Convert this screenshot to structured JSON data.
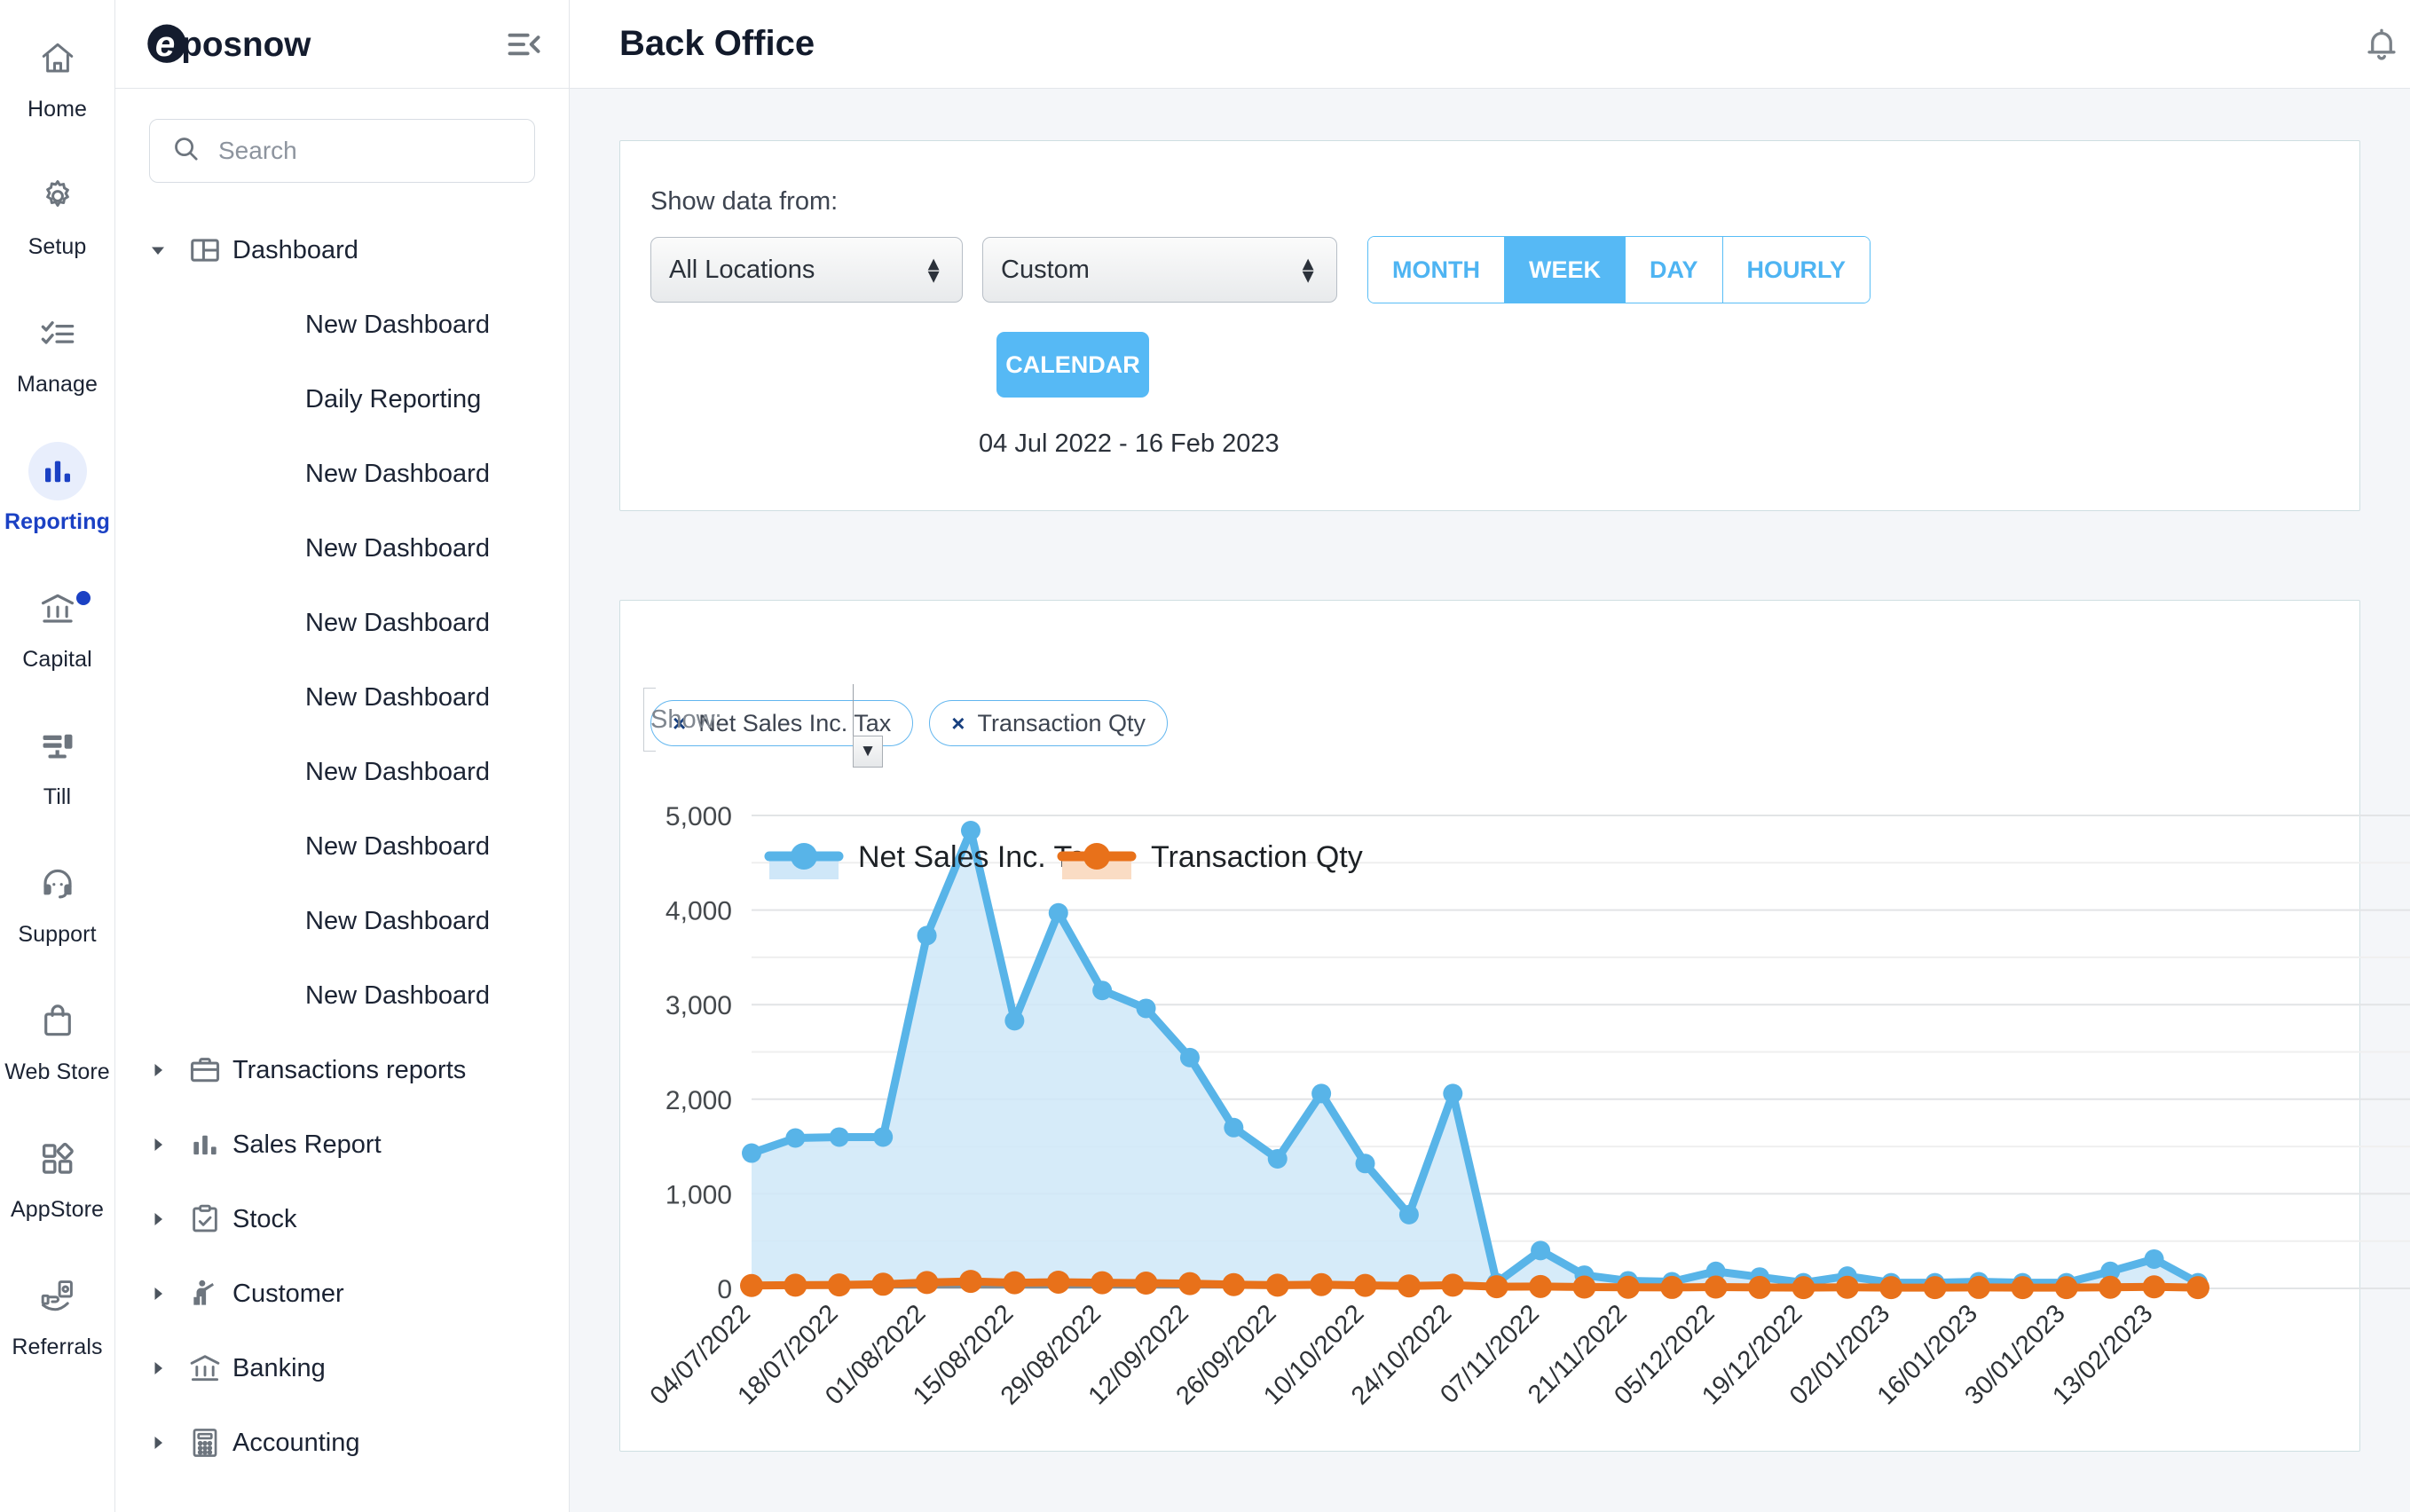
{
  "rail": {
    "items": [
      {
        "label": "Home",
        "icon": "home-icon",
        "active": false,
        "dot": false
      },
      {
        "label": "Setup",
        "icon": "gear-icon",
        "active": false,
        "dot": false
      },
      {
        "label": "Manage",
        "icon": "checklist-icon",
        "active": false,
        "dot": false
      },
      {
        "label": "Reporting",
        "icon": "bar-chart-icon",
        "active": true,
        "dot": false
      },
      {
        "label": "Capital",
        "icon": "bank-icon",
        "active": false,
        "dot": true
      },
      {
        "label": "Till",
        "icon": "till-icon",
        "active": false,
        "dot": false
      },
      {
        "label": "Support",
        "icon": "headset-icon",
        "active": false,
        "dot": false
      },
      {
        "label": "Web Store",
        "icon": "shopping-bag-icon",
        "active": false,
        "dot": false
      },
      {
        "label": "AppStore",
        "icon": "apps-grid-icon",
        "active": false,
        "dot": false
      },
      {
        "label": "Referrals",
        "icon": "hand-money-icon",
        "active": false,
        "dot": false
      }
    ],
    "active_color": "#1b41c4"
  },
  "nav": {
    "brand": "eposnow",
    "collapse_icon": "collapse-menu-icon",
    "search": {
      "value": "",
      "placeholder": "Search",
      "icon": "search-icon"
    },
    "tree": [
      {
        "label": "Dashboard",
        "icon": "dashboard-layout-icon",
        "expanded": true,
        "children": [
          "New Dashboard",
          "Daily Reporting",
          "New Dashboard",
          "New Dashboard",
          "New Dashboard",
          "New Dashboard",
          "New Dashboard",
          "New Dashboard",
          "New Dashboard",
          "New Dashboard"
        ]
      },
      {
        "label": "Transactions reports",
        "icon": "briefcase-icon",
        "expanded": false,
        "children": []
      },
      {
        "label": "Sales Report",
        "icon": "bar-chart-icon",
        "expanded": false,
        "children": []
      },
      {
        "label": "Stock",
        "icon": "clipboard-check-icon",
        "expanded": false,
        "children": []
      },
      {
        "label": "Customer",
        "icon": "person-chart-icon",
        "expanded": false,
        "children": []
      },
      {
        "label": "Banking",
        "icon": "bank-icon",
        "expanded": false,
        "children": []
      },
      {
        "label": "Accounting",
        "icon": "calculator-icon",
        "expanded": false,
        "children": []
      }
    ]
  },
  "topbar": {
    "title": "Back Office",
    "bell_icon": "notification-bell-icon"
  },
  "filters": {
    "label": "Show data from:",
    "location_select": {
      "value": "All Locations",
      "options": [
        "All Locations"
      ]
    },
    "period_select": {
      "value": "Custom",
      "options": [
        "Custom"
      ]
    },
    "granularity": [
      {
        "label": "MONTH",
        "selected": false
      },
      {
        "label": "WEEK",
        "selected": true
      },
      {
        "label": "DAY",
        "selected": false
      },
      {
        "label": "HOURLY",
        "selected": false
      }
    ],
    "calendar_button": "CALENDAR",
    "date_range": "04 Jul 2022 - 16 Feb 2023",
    "accent": "#56b9f5"
  },
  "chart_panel": {
    "show_label": "Show:",
    "dropdown_icon": "chevron-down-icon",
    "chips": [
      {
        "remove": "×",
        "label": "Net Sales Inc. Tax"
      },
      {
        "remove": "×",
        "label": "Transaction Qty"
      }
    ]
  },
  "chart_data": {
    "type": "area",
    "title": "",
    "xlabel": "",
    "ylabel": "",
    "ylim": [
      0,
      5000
    ],
    "yticks": [
      0,
      1000,
      2000,
      3000,
      4000,
      5000
    ],
    "ytick_labels": [
      "0",
      "1,000",
      "2,000",
      "3,000",
      "4,000",
      "5,000"
    ],
    "gridline_step": 500,
    "grid": true,
    "legend_position": "top-left",
    "x": [
      "04/07/2022",
      "11/07/2022",
      "18/07/2022",
      "25/07/2022",
      "01/08/2022",
      "08/08/2022",
      "15/08/2022",
      "22/08/2022",
      "29/08/2022",
      "05/09/2022",
      "12/09/2022",
      "19/09/2022",
      "26/09/2022",
      "03/10/2022",
      "10/10/2022",
      "17/10/2022",
      "24/10/2022",
      "31/10/2022",
      "07/11/2022",
      "14/11/2022",
      "21/11/2022",
      "28/11/2022",
      "05/12/2022",
      "12/12/2022",
      "19/12/2022",
      "26/12/2022",
      "02/01/2023",
      "09/01/2023",
      "16/01/2023",
      "23/01/2023",
      "30/01/2023",
      "06/02/2023",
      "13/02/2023",
      "20/02/2023"
    ],
    "xtick_labels": [
      "04/07/2022",
      "18/07/2022",
      "01/08/2022",
      "15/08/2022",
      "29/08/2022",
      "12/09/2022",
      "26/09/2022",
      "10/10/2022",
      "24/10/2022",
      "07/11/2022",
      "21/11/2022",
      "05/12/2022",
      "19/12/2022",
      "02/01/2023",
      "16/01/2023",
      "30/01/2023",
      "13/02/2023"
    ],
    "xtick_every": 2,
    "xtick_rotation": -45,
    "series": [
      {
        "name": "Net Sales Inc. Tax",
        "color": "#58b4e8",
        "fill": "#cfe7f8",
        "values": [
          1430,
          1590,
          1600,
          1600,
          3730,
          4840,
          2830,
          3970,
          3150,
          2960,
          2440,
          1700,
          1370,
          2060,
          1320,
          780,
          2060,
          60,
          400,
          140,
          80,
          70,
          180,
          120,
          60,
          130,
          60,
          60,
          70,
          60,
          60,
          180,
          310,
          60
        ]
      },
      {
        "name": "Transaction Qty",
        "color": "#e8711a",
        "fill": "#fadcc4",
        "values": [
          30,
          34,
          36,
          44,
          62,
          74,
          60,
          66,
          60,
          56,
          50,
          40,
          34,
          40,
          32,
          26,
          34,
          18,
          20,
          14,
          12,
          10,
          14,
          10,
          8,
          12,
          8,
          8,
          10,
          8,
          8,
          12,
          16,
          8
        ]
      }
    ]
  }
}
